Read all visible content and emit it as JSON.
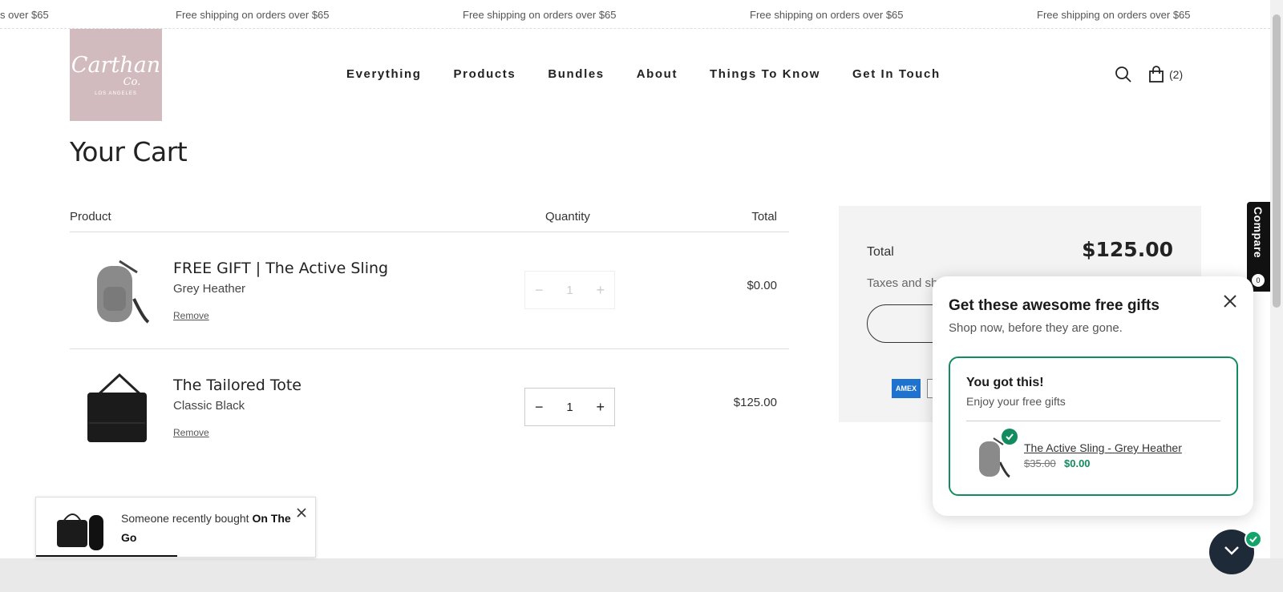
{
  "announcement": {
    "items": [
      "s over $65",
      "Free shipping on orders over $65",
      "Free shipping on orders over $65",
      "Free shipping on orders over $65",
      "Free shipping on orders over $65"
    ]
  },
  "logo": {
    "script": "Carthan",
    "co": "Co.",
    "tagline": "LOS ANGELES"
  },
  "nav": {
    "items": [
      "Everything",
      "Products",
      "Bundles",
      "About",
      "Things To Know",
      "Get In Touch"
    ]
  },
  "header": {
    "cart_count": "(2)",
    "search_icon": "search-icon",
    "cart_icon": "shopping-bag-icon"
  },
  "page": {
    "title": "Your Cart"
  },
  "cart_table": {
    "headers": {
      "product": "Product",
      "quantity": "Quantity",
      "total": "Total"
    },
    "rows": [
      {
        "name": "FREE GIFT | The Active Sling",
        "variant": "Grey Heather",
        "remove": "Remove",
        "qty": "1",
        "total": "$0.00",
        "minus": "−",
        "plus": "+"
      },
      {
        "name": "The Tailored Tote",
        "variant": "Classic Black",
        "remove": "Remove",
        "qty": "1",
        "total": "$125.00",
        "minus": "−",
        "plus": "+"
      }
    ]
  },
  "summary": {
    "total_label": "Total",
    "total_value": "$125.00",
    "tax_text": "Taxes and sh",
    "amex": "AMEX"
  },
  "compare": {
    "label": "Compare",
    "count": "0"
  },
  "gift_popup": {
    "title": "Get these awesome free gifts",
    "subtitle": "Shop now, before they are gone.",
    "card_title": "You got this!",
    "card_subtitle": "Enjoy your free gifts",
    "item_name": "The Active Sling - Grey Heather",
    "old_price": "$35.00",
    "new_price": "$0.00"
  },
  "toast": {
    "text": "Someone recently bought ",
    "product": "On The Go"
  },
  "colors": {
    "accent_green": "#128c5e",
    "logo_bg": "#d2bbbf",
    "summary_bg": "#f3f3f3",
    "chat_bg": "#1e2a38"
  }
}
